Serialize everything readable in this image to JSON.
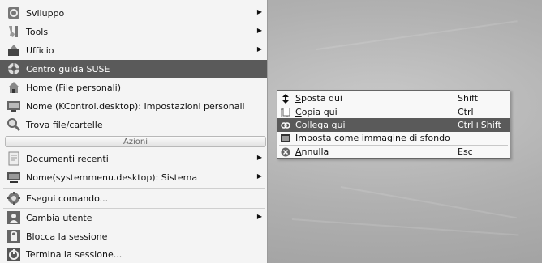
{
  "kmenu": {
    "items": [
      {
        "label": "Sviluppo",
        "icon": "development-icon",
        "submenu": true
      },
      {
        "label": "Tools",
        "icon": "tools-icon",
        "submenu": true
      },
      {
        "label": "Ufficio",
        "icon": "office-icon",
        "submenu": true
      },
      {
        "label": "Centro guida SUSE",
        "icon": "help-lifebuoy-icon",
        "submenu": false,
        "selected": true
      },
      {
        "label": "Home (File personali)",
        "icon": "home-icon",
        "submenu": false
      },
      {
        "label": "Nome (KControl.desktop): Impostazioni personali",
        "icon": "control-center-icon",
        "submenu": false
      },
      {
        "label": "Trova file/cartelle",
        "icon": "find-icon",
        "submenu": false
      }
    ],
    "section_label": "Azioni",
    "actions": [
      {
        "label": "Documenti recenti",
        "icon": "recent-documents-icon",
        "submenu": true
      },
      {
        "label": "Nome(systemmenu.desktop): Sistema",
        "icon": "system-icon",
        "submenu": true
      },
      {
        "label": "Esegui comando...",
        "icon": "run-command-icon",
        "submenu": false
      },
      {
        "label": "Cambia utente",
        "icon": "switch-user-icon",
        "submenu": true
      },
      {
        "label": "Blocca la sessione",
        "icon": "lock-icon",
        "submenu": false
      },
      {
        "label": "Termina la sessione...",
        "icon": "logout-icon",
        "submenu": false
      }
    ]
  },
  "popup": {
    "items": [
      {
        "label": "Sposta qui",
        "mnemonic": "S",
        "shortcut": "Shift",
        "icon": "move-icon"
      },
      {
        "label": "Copia qui",
        "mnemonic": "C",
        "shortcut": "Ctrl",
        "icon": "copy-icon"
      },
      {
        "label": "Collega qui",
        "mnemonic": "C",
        "shortcut": "Ctrl+Shift",
        "icon": "link-icon",
        "selected": true
      },
      {
        "label": "Imposta come immagine di sfondo",
        "mnemonic": "i",
        "shortcut": "",
        "icon": "wallpaper-icon"
      },
      {
        "label": "Annulla",
        "mnemonic": "A",
        "shortcut": "Esc",
        "icon": "cancel-icon"
      }
    ]
  },
  "colors": {
    "selection": "#5a5a5a",
    "menu_bg": "#f4f4f4",
    "desktop": "#b0b0b0"
  }
}
